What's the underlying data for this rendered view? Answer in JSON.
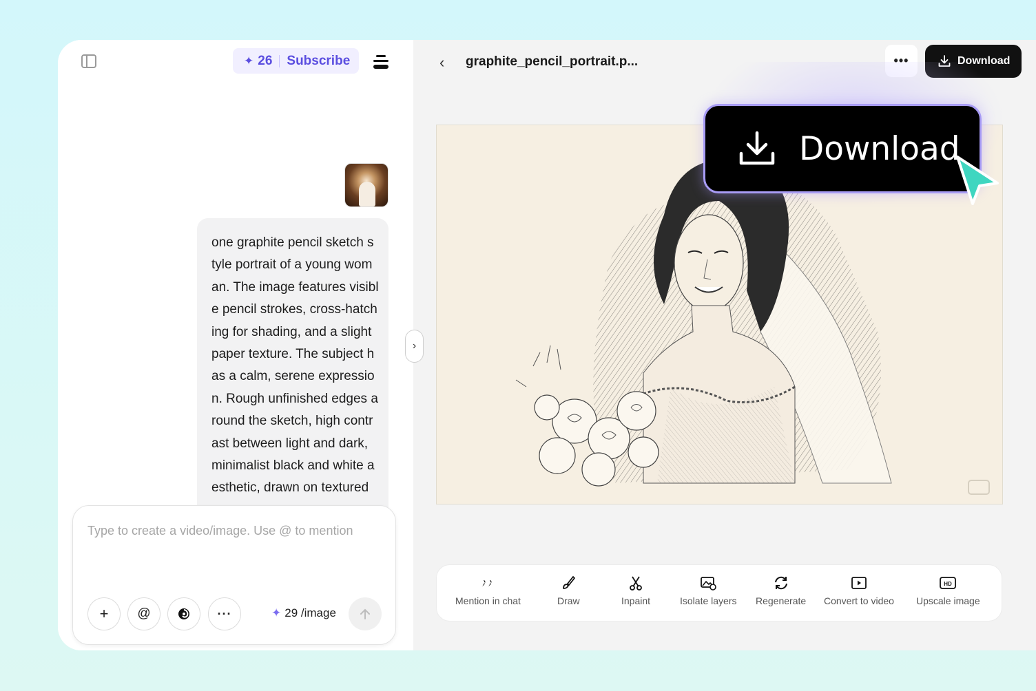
{
  "header": {
    "credits_count": "26",
    "subscribe_label": "Subscribe"
  },
  "chat": {
    "message_lines": [
      "one graphite pencil sketch s",
      "tyle portrait of a young wom",
      "an. The image features visibl",
      "e pencil strokes, cross-hatch",
      "ing for shading, and a slight",
      "paper texture. The subject h",
      "as a calm, serene expressio",
      "n. Rough unfinished edges a",
      "round the sketch, high contr",
      "ast between light and dark,",
      "minimalist black and white a",
      "esthetic, drawn on textured"
    ]
  },
  "composer": {
    "placeholder": "Type to create a video/image. Use @ to mention",
    "credits_cost": "29 /image",
    "plus_icon": "plus-icon",
    "mention_icon": "at-icon",
    "model_icon": "model-swirl-icon",
    "more_icon": "more-horizontal-icon",
    "send_icon": "arrow-up-icon"
  },
  "viewer": {
    "file_title": "graphite_pencil_portrait.p...",
    "more_label": "•••",
    "download_label": "Download"
  },
  "toolbar": {
    "items": [
      {
        "label": "Mention in chat",
        "icon": "quote-icon"
      },
      {
        "label": "Draw",
        "icon": "brush-icon"
      },
      {
        "label": "Inpaint",
        "icon": "scissors-icon"
      },
      {
        "label": "Isolate layers",
        "icon": "image-layers-icon"
      },
      {
        "label": "Regenerate",
        "icon": "refresh-icon"
      },
      {
        "label": "Convert to video",
        "icon": "play-icon"
      },
      {
        "label": "Upscale image",
        "icon": "hd-icon"
      }
    ]
  },
  "callout": {
    "label": "Download"
  },
  "colors": {
    "accent": "#5b4ee0",
    "cursor": "#3fd6c0",
    "callout_border": "#a89cf5"
  }
}
